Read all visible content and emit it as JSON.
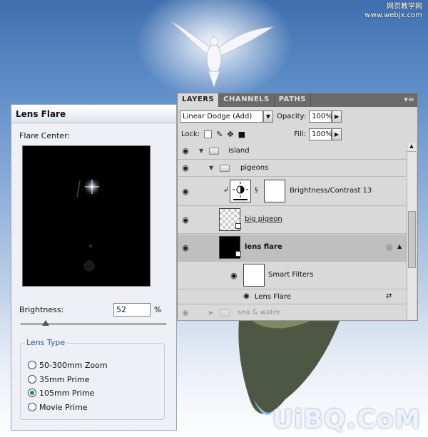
{
  "watermark": {
    "top_line1": "网页教学网",
    "top_line2": "www.webjx.com",
    "bottom": "UiBQ.CoM"
  },
  "lens_flare_dialog": {
    "title": "Lens Flare",
    "flare_center_label": "Flare Center:",
    "brightness_label": "Brightness:",
    "brightness_value": "52",
    "brightness_unit": "%",
    "brightness_slider_percent": 52,
    "lens_type_legend": "Lens Type",
    "lens_types": [
      {
        "label": "50-300mm Zoom",
        "selected": false
      },
      {
        "label": "35mm Prime",
        "selected": false
      },
      {
        "label": "105mm Prime",
        "selected": true
      },
      {
        "label": "Movie Prime",
        "selected": false
      }
    ]
  },
  "layers_panel": {
    "tabs": [
      "LAYERS",
      "CHANNELS",
      "PATHS"
    ],
    "active_tab": "LAYERS",
    "blend_mode": "Linear Dodge (Add)",
    "opacity_label": "Opacity:",
    "opacity_value": "100%",
    "lock_label": "Lock:",
    "fill_label": "Fill:",
    "fill_value": "100%",
    "layers": [
      {
        "name": "island",
        "kind": "group"
      },
      {
        "name": "pigeons",
        "kind": "group"
      },
      {
        "name": "Brightness/Contrast 13",
        "kind": "adjustment"
      },
      {
        "name": "big pigeon",
        "kind": "smart-object"
      },
      {
        "name": "lens flare",
        "kind": "smart-object",
        "selected": true
      },
      {
        "name": "Smart Filters",
        "kind": "smart-filters"
      },
      {
        "name": "Lens Flare",
        "kind": "filter"
      },
      {
        "name": "sea & water",
        "kind": "group",
        "faded": true
      }
    ]
  },
  "colors": {
    "radio_selected": "#2b8a3e",
    "legend_text": "#2b58a6",
    "panel_bg": "#d9d9d9",
    "selected_row": "#bfbfbf"
  }
}
